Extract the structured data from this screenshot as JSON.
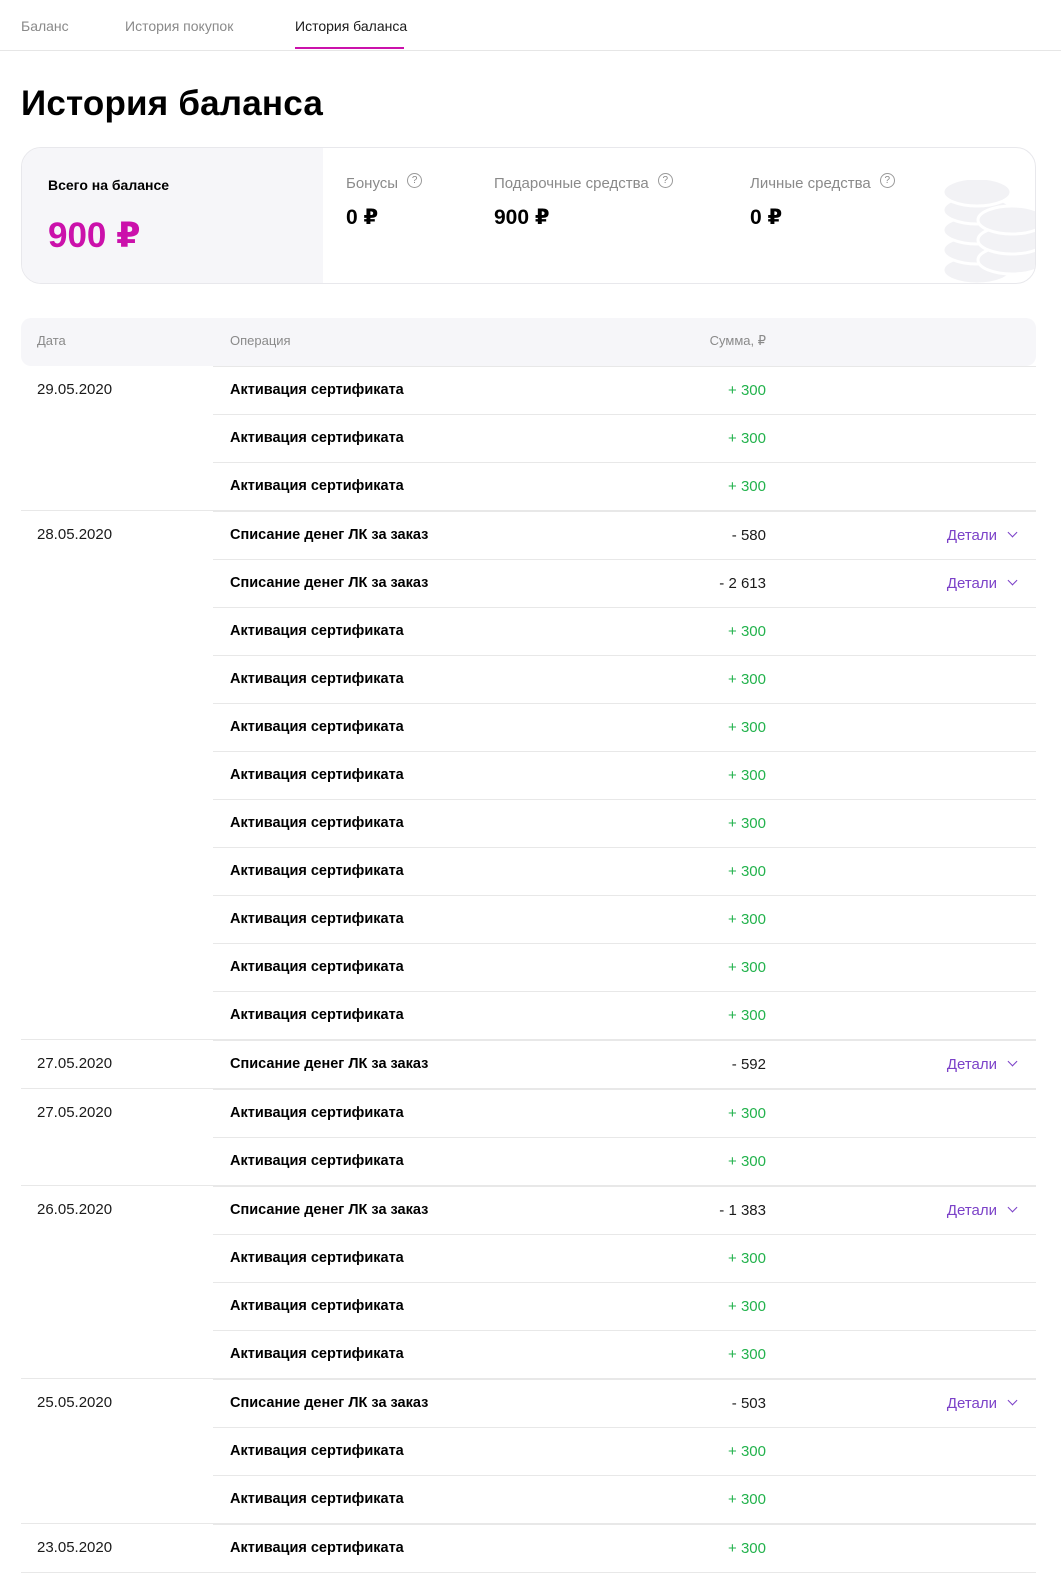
{
  "tabs": [
    {
      "label": "Баланс"
    },
    {
      "label": "История покупок"
    },
    {
      "label": "История баланса"
    }
  ],
  "page_title": "История баланса",
  "summary": {
    "total_label": "Всего на балансе",
    "total_value": "900 ₽",
    "bonuses_label": "Бонусы",
    "bonuses_value": "0 ₽",
    "gift_label": "Подарочные средства",
    "gift_value": "900 ₽",
    "personal_label": "Личные средства",
    "personal_value": "0 ₽",
    "help_icon": "question-circle-icon",
    "decor_icon": "coins-stack-icon"
  },
  "table": {
    "headers": {
      "date": "Дата",
      "operation": "Операция",
      "amount": "Сумма, ₽"
    },
    "details_label": "Детали",
    "groups": [
      {
        "date": "29.05.2020",
        "rows": [
          {
            "op": "Активация сертификата",
            "amount": "+ 300",
            "type": "pos"
          },
          {
            "op": "Активация сертификата",
            "amount": "+ 300",
            "type": "pos"
          },
          {
            "op": "Активация сертификата",
            "amount": "+ 300",
            "type": "pos"
          }
        ]
      },
      {
        "date": "28.05.2020",
        "rows": [
          {
            "op": "Списание денег ЛК за заказ",
            "amount": "- 580",
            "type": "neg",
            "details": true
          },
          {
            "op": "Списание денег ЛК за заказ",
            "amount": "- 2 613",
            "type": "neg",
            "details": true
          },
          {
            "op": "Активация сертификата",
            "amount": "+ 300",
            "type": "pos"
          },
          {
            "op": "Активация сертификата",
            "amount": "+ 300",
            "type": "pos"
          },
          {
            "op": "Активация сертификата",
            "amount": "+ 300",
            "type": "pos"
          },
          {
            "op": "Активация сертификата",
            "amount": "+ 300",
            "type": "pos"
          },
          {
            "op": "Активация сертификата",
            "amount": "+ 300",
            "type": "pos"
          },
          {
            "op": "Активация сертификата",
            "amount": "+ 300",
            "type": "pos"
          },
          {
            "op": "Активация сертификата",
            "amount": "+ 300",
            "type": "pos"
          },
          {
            "op": "Активация сертификата",
            "amount": "+ 300",
            "type": "pos"
          },
          {
            "op": "Активация сертификата",
            "amount": "+ 300",
            "type": "pos"
          }
        ]
      },
      {
        "date": "27.05.2020",
        "rows": [
          {
            "op": "Списание денег ЛК за заказ",
            "amount": "- 592",
            "type": "neg",
            "details": true
          }
        ]
      },
      {
        "date": "27.05.2020",
        "rows": [
          {
            "op": "Активация сертификата",
            "amount": "+ 300",
            "type": "pos"
          },
          {
            "op": "Активация сертификата",
            "amount": "+ 300",
            "type": "pos"
          }
        ]
      },
      {
        "date": "26.05.2020",
        "rows": [
          {
            "op": "Списание денег ЛК за заказ",
            "amount": "- 1 383",
            "type": "neg",
            "details": true
          },
          {
            "op": "Активация сертификата",
            "amount": "+ 300",
            "type": "pos"
          },
          {
            "op": "Активация сертификата",
            "amount": "+ 300",
            "type": "pos"
          },
          {
            "op": "Активация сертификата",
            "amount": "+ 300",
            "type": "pos"
          }
        ]
      },
      {
        "date": "25.05.2020",
        "rows": [
          {
            "op": "Списание денег ЛК за заказ",
            "amount": "- 503",
            "type": "neg",
            "details": true
          },
          {
            "op": "Активация сертификата",
            "amount": "+ 300",
            "type": "pos"
          },
          {
            "op": "Активация сертификата",
            "amount": "+ 300",
            "type": "pos"
          }
        ]
      },
      {
        "date": "23.05.2020",
        "rows": [
          {
            "op": "Активация сертификата",
            "amount": "+ 300",
            "type": "pos"
          }
        ]
      }
    ]
  },
  "colors": {
    "accent": "#cb11ab",
    "positive": "#22b24c",
    "link": "#7b41c8"
  }
}
